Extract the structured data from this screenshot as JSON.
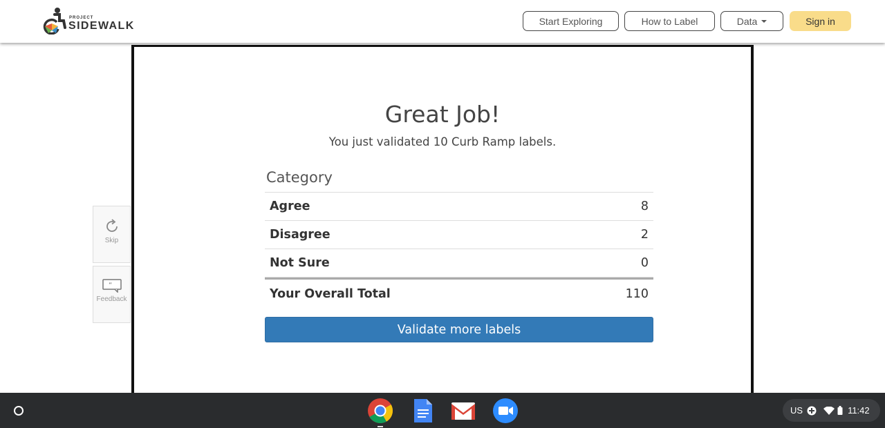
{
  "header": {
    "logo_small": "PROJECT",
    "logo_name": "SIDEWALK",
    "nav": {
      "start_exploring": "Start Exploring",
      "how_to_label": "How to Label",
      "data": "Data",
      "sign_in": "Sign in"
    }
  },
  "sidebar": {
    "skip_label": "Skip",
    "feedback_label": "Feedback"
  },
  "main": {
    "title": "Great Job!",
    "subtitle": "You just validated 10 Curb Ramp labels.",
    "table_header": "Category",
    "rows": [
      {
        "label": "Agree",
        "value": "8"
      },
      {
        "label": "Disagree",
        "value": "2"
      },
      {
        "label": "Not Sure",
        "value": "0"
      }
    ],
    "total": {
      "label": "Your Overall Total",
      "value": "110"
    },
    "validate_button": "Validate more labels"
  },
  "shelf": {
    "apps": [
      "chrome-icon",
      "google-docs-icon",
      "gmail-icon",
      "zoom-icon"
    ],
    "status": {
      "keyboard": "US",
      "time": "11:42"
    }
  },
  "colors": {
    "accent_blue": "#337ab7",
    "signin_yellow": "#f9dc8a",
    "shelf_bg": "#2a2c2e"
  }
}
